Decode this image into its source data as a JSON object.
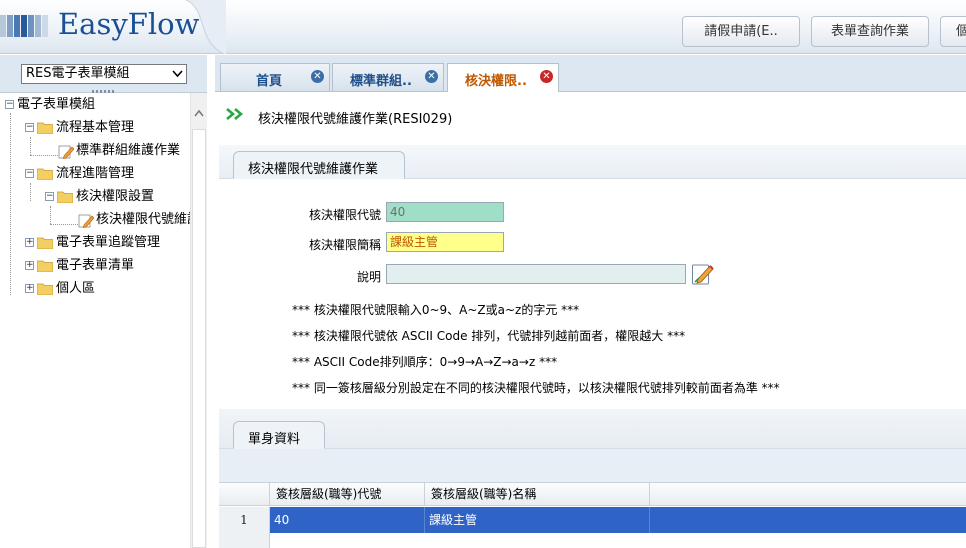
{
  "header": {
    "brand": "EasyFlow",
    "buttons": [
      "請假申請(E..",
      "表單查詢作業",
      "個"
    ]
  },
  "sidebar": {
    "module_select": "RES電子表單模組",
    "tree": [
      {
        "label": "電子表單模組"
      },
      {
        "label": "流程基本管理"
      },
      {
        "label": "標準群組維護作業"
      },
      {
        "label": "流程進階管理"
      },
      {
        "label": "核決權限設置"
      },
      {
        "label": "核決權限代號維護作業"
      },
      {
        "label": "電子表單追蹤管理"
      },
      {
        "label": "電子表單清單"
      },
      {
        "label": "個人區"
      }
    ]
  },
  "tabs": [
    {
      "label": "首頁",
      "active": false
    },
    {
      "label": "標準群組..",
      "active": false
    },
    {
      "label": "核決權限..",
      "active": true
    }
  ],
  "page": {
    "title": "核決權限代號維護作業(RESI029)",
    "section1_tab": "核決權限代號維護作業",
    "section2_tab": "單身資料"
  },
  "form": {
    "code_label": "核決權限代號",
    "code_value": "40",
    "name_label": "核決權限簡稱",
    "name_value": "課級主管",
    "desc_label": "說明",
    "desc_value": "",
    "notes": [
      "*** 核決權限代號限輸入0~9、A~Z或a~z的字元 ***",
      "*** 核決權限代號依 ASCII Code 排列，代號排列越前面者，權限越大 ***",
      "*** ASCII Code排列順序：0→9→A→Z→a→z ***",
      "*** 同一簽核層級分別設定在不同的核決權限代號時，以核決權限代號排列較前面者為準 ***"
    ]
  },
  "grid": {
    "columns": [
      "",
      "簽核層級(職等)代號",
      "簽核層級(職等)名稱",
      ""
    ],
    "rows": [
      {
        "num": "1",
        "code": "40",
        "name": "課級主管"
      }
    ]
  },
  "colors": {
    "accent": "#1a4f93",
    "selected_row": "#2f63c5",
    "code_field_bg": "#9fdfc7",
    "name_field_bg": "#ffff8c",
    "desc_field_bg": "#e3efee"
  }
}
